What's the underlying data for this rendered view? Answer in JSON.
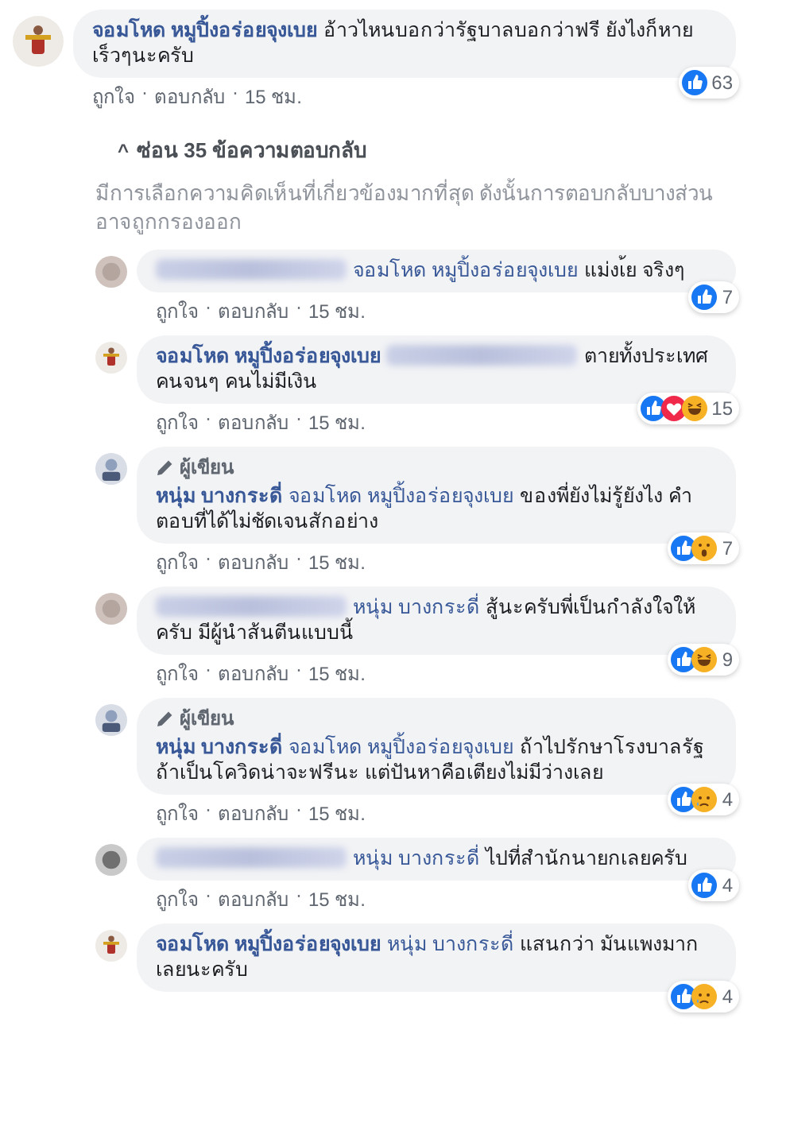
{
  "meta_separator": "·",
  "top_comment": {
    "avatar": {
      "kind": "figure"
    },
    "parts": [
      {
        "kind": "author",
        "text": "จอมโหด หมูปิ้งอร่อยจุงเบย"
      },
      {
        "kind": "text",
        "text": "อ้าวไหนบอกว่ารัฐบาลบอกว่าฟรี ยังไงก็หายเร็วๆนะครับ"
      }
    ],
    "reactions": [
      {
        "kind": "like"
      }
    ],
    "count": "63",
    "actions": [
      "ถูกใจ",
      "ตอบกลับ",
      "15 ชม."
    ]
  },
  "hide_replies": {
    "caret": "^",
    "label": "ซ่อน 35 ข้อความตอบกลับ"
  },
  "filter_note": "มีการเลือกความคิดเห็นที่เกี่ยวข้องมากที่สุด ดังนั้นการตอบกลับบางส่วนอาจถูกกรองออก",
  "replies": [
    {
      "avatar": {
        "kind": "blurred"
      },
      "parts": [
        {
          "kind": "redacted"
        },
        {
          "kind": "mention",
          "text": "จอมโหด หมูปิ้งอร่อยจุงเบย"
        },
        {
          "kind": "text",
          "text": "แม่งเ้ย จริงๆ"
        }
      ],
      "reactions": [
        {
          "kind": "like"
        }
      ],
      "count": "7",
      "actions": [
        "ถูกใจ",
        "ตอบกลับ",
        "15 ชม."
      ]
    },
    {
      "avatar": {
        "kind": "figure"
      },
      "parts": [
        {
          "kind": "author",
          "text": "จอมโหด หมูปิ้งอร่อยจุงเบย"
        },
        {
          "kind": "redacted"
        },
        {
          "kind": "text",
          "text": "ตายทั้งประเทศ คนจนๆ คนไม่มีเงิน"
        }
      ],
      "reactions": [
        {
          "kind": "like"
        },
        {
          "kind": "love"
        },
        {
          "kind": "haha"
        }
      ],
      "count": "15",
      "actions": [
        "ถูกใจ",
        "ตอบกลับ",
        "15 ชม."
      ]
    },
    {
      "avatar": {
        "kind": "rider"
      },
      "badge": "ผู้เขียน",
      "parts": [
        {
          "kind": "author",
          "text": "หนุ่ม บางกระดี่"
        },
        {
          "kind": "mention",
          "text": "จอมโหด หมูปิ้งอร่อยจุงเบย"
        },
        {
          "kind": "text",
          "text": "ของพี่ยังไม่รู้ยังไง คำตอบที่ได้ไม่ชัดเจนสักอย่าง"
        }
      ],
      "reactions": [
        {
          "kind": "like"
        },
        {
          "kind": "wow"
        }
      ],
      "count": "7",
      "actions": [
        "ถูกใจ",
        "ตอบกลับ",
        "15 ชม."
      ]
    },
    {
      "avatar": {
        "kind": "blurred"
      },
      "parts": [
        {
          "kind": "redacted"
        },
        {
          "kind": "mention",
          "text": "หนุ่ม บางกระดี่"
        },
        {
          "kind": "text",
          "text": "สู้นะครับพี่เป็นกำลังใจให้ครับ มีผู้นำส้นตีนแบบนี้"
        }
      ],
      "reactions": [
        {
          "kind": "like"
        },
        {
          "kind": "haha"
        }
      ],
      "count": "9",
      "actions": [
        "ถูกใจ",
        "ตอบกลับ",
        "15 ชม."
      ]
    },
    {
      "avatar": {
        "kind": "rider"
      },
      "badge": "ผู้เขียน",
      "parts": [
        {
          "kind": "author",
          "text": "หนุ่ม บางกระดี่"
        },
        {
          "kind": "mention",
          "text": "จอมโหด หมูปิ้งอร่อยจุงเบย"
        },
        {
          "kind": "text",
          "text": "ถ้าไปรักษาโรงบาลรัฐถ้าเป็นโควิดน่าจะฟรีนะ แต่ปันหาคือเตียงไม่มีว่างเลย"
        }
      ],
      "reactions": [
        {
          "kind": "like"
        },
        {
          "kind": "sad"
        }
      ],
      "count": "4",
      "actions": [
        "ถูกใจ",
        "ตอบกลับ",
        "15 ชม."
      ]
    },
    {
      "avatar": {
        "kind": "dark"
      },
      "parts": [
        {
          "kind": "redacted"
        },
        {
          "kind": "mention",
          "text": "หนุ่ม บางกระดี่"
        },
        {
          "kind": "text",
          "text": "ไปที่สำนักนายกเลยครับ"
        }
      ],
      "reactions": [
        {
          "kind": "like"
        }
      ],
      "count": "4",
      "actions": [
        "ถูกใจ",
        "ตอบกลับ",
        "15 ชม."
      ]
    },
    {
      "avatar": {
        "kind": "figure"
      },
      "parts": [
        {
          "kind": "author",
          "text": "จอมโหด หมูปิ้งอร่อยจุงเบย"
        },
        {
          "kind": "mention",
          "text": "หนุ่ม บางกระดี่"
        },
        {
          "kind": "text",
          "text": "แสนกว่า มันแพงมากเลยนะครับ"
        }
      ],
      "reactions": [
        {
          "kind": "like"
        },
        {
          "kind": "sad"
        }
      ],
      "count": "4"
    }
  ]
}
